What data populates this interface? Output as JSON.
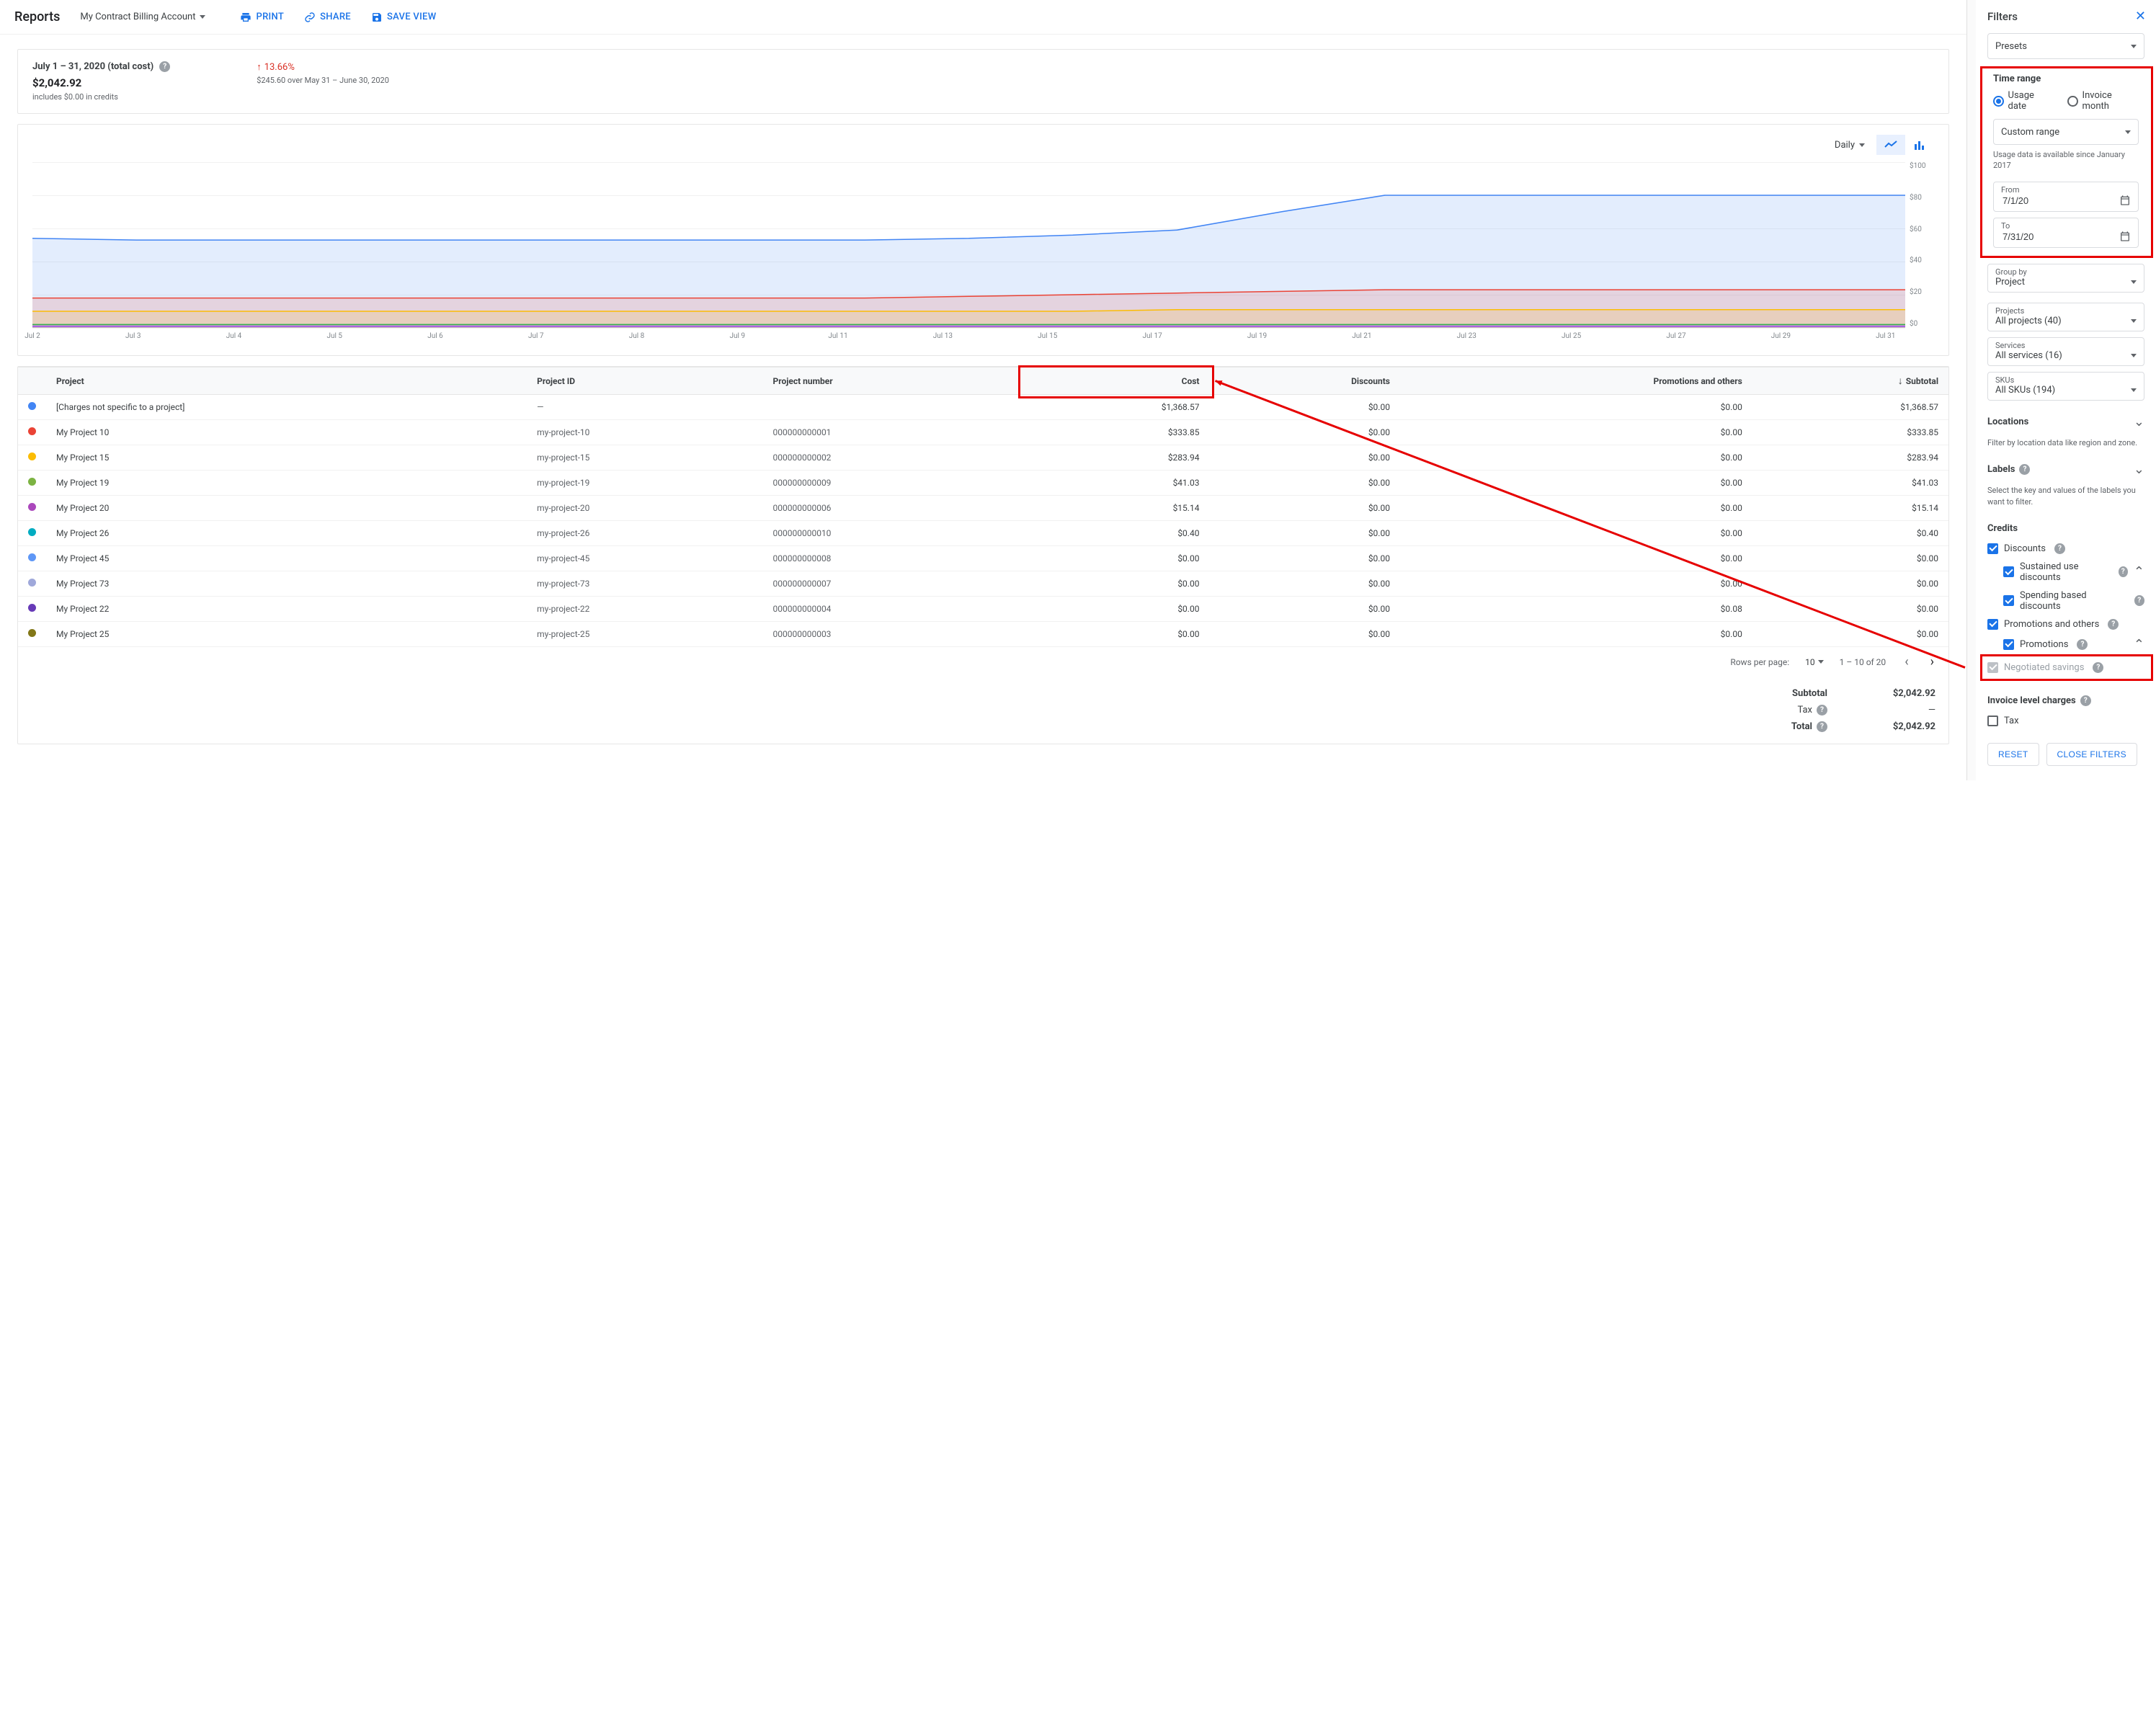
{
  "topbar": {
    "title": "Reports",
    "account": "My Contract Billing Account",
    "print": "PRINT",
    "share": "SHARE",
    "save_view": "SAVE VIEW"
  },
  "summary": {
    "period_label": "July 1 – 31, 2020 (total cost)",
    "amount": "$2,042.92",
    "credits_note": "includes $0.00 in credits",
    "delta_pct": "13.66%",
    "delta_note": "$245.60 over May 31 – June 30, 2020"
  },
  "chart_controls": {
    "granularity": "Daily"
  },
  "chart_data": {
    "type": "area",
    "ylabel": "",
    "ylim": [
      0,
      100
    ],
    "yticks": [
      "$100",
      "$80",
      "$60",
      "$40",
      "$20",
      "$0"
    ],
    "categories": [
      "Jul 2",
      "Jul 3",
      "Jul 4",
      "Jul 5",
      "Jul 6",
      "Jul 7",
      "Jul 8",
      "Jul 9",
      "Jul 11",
      "Jul 13",
      "Jul 15",
      "Jul 17",
      "Jul 19",
      "Jul 21",
      "Jul 23",
      "Jul 25",
      "Jul 27",
      "Jul 29",
      "Jul 31"
    ],
    "series": [
      {
        "name": "[Charges not specific to a project]",
        "color": "#4285f4",
        "values": [
          54,
          53,
          53,
          53,
          53,
          53,
          53,
          53,
          53,
          54,
          56,
          59,
          70,
          80,
          80,
          80,
          80,
          80,
          80
        ]
      },
      {
        "name": "My Project 10",
        "color": "#ea4335",
        "values": [
          18,
          18,
          18,
          18,
          18,
          18,
          18,
          18,
          18,
          19,
          20,
          21,
          22,
          23,
          23,
          23,
          23,
          23,
          23
        ]
      },
      {
        "name": "My Project 15",
        "color": "#fbbc04",
        "values": [
          10,
          10,
          10,
          10,
          10,
          10,
          10,
          10,
          10,
          10,
          10,
          11,
          11,
          11,
          11,
          11,
          11,
          11,
          11
        ]
      },
      {
        "name": "My Project 19",
        "color": "#34a853",
        "values": [
          2,
          2,
          2,
          2,
          2,
          2,
          2,
          2,
          2,
          2,
          2,
          2,
          2,
          2,
          2,
          2,
          2,
          2,
          2
        ]
      },
      {
        "name": "My Project 20",
        "color": "#a142f4",
        "values": [
          1,
          1,
          1,
          1,
          1,
          1,
          1,
          1,
          1,
          1,
          1,
          1,
          1,
          1,
          1,
          1,
          1,
          1,
          1
        ]
      }
    ]
  },
  "table": {
    "headers": {
      "project": "Project",
      "project_id": "Project ID",
      "project_number": "Project number",
      "cost": "Cost",
      "discounts": "Discounts",
      "promotions": "Promotions and others",
      "subtotal": "Subtotal"
    },
    "rows": [
      {
        "dot": "#4285f4",
        "project": "[Charges not specific to a project]",
        "pid": "—",
        "pnum": "",
        "cost": "$1,368.57",
        "disc": "$0.00",
        "promo": "$0.00",
        "sub": "$1,368.57"
      },
      {
        "dot": "#ea4335",
        "project": "My Project 10",
        "pid": "my-project-10",
        "pnum": "000000000001",
        "cost": "$333.85",
        "disc": "$0.00",
        "promo": "$0.00",
        "sub": "$333.85"
      },
      {
        "dot": "#fbbc04",
        "project": "My Project 15",
        "pid": "my-project-15",
        "pnum": "000000000002",
        "cost": "$283.94",
        "disc": "$0.00",
        "promo": "$0.00",
        "sub": "$283.94"
      },
      {
        "dot": "#7cb342",
        "project": "My Project 19",
        "pid": "my-project-19",
        "pnum": "000000000009",
        "cost": "$41.03",
        "disc": "$0.00",
        "promo": "$0.00",
        "sub": "$41.03"
      },
      {
        "dot": "#ab47bc",
        "project": "My Project 20",
        "pid": "my-project-20",
        "pnum": "000000000006",
        "cost": "$15.14",
        "disc": "$0.00",
        "promo": "$0.00",
        "sub": "$15.14"
      },
      {
        "dot": "#00acc1",
        "project": "My Project 26",
        "pid": "my-project-26",
        "pnum": "000000000010",
        "cost": "$0.40",
        "disc": "$0.00",
        "promo": "$0.00",
        "sub": "$0.40"
      },
      {
        "dot": "#5e97f6",
        "project": "My Project 45",
        "pid": "my-project-45",
        "pnum": "000000000008",
        "cost": "$0.00",
        "disc": "$0.00",
        "promo": "$0.00",
        "sub": "$0.00"
      },
      {
        "dot": "#9fa8da",
        "project": "My Project 73",
        "pid": "my-project-73",
        "pnum": "000000000007",
        "cost": "$0.00",
        "disc": "$0.00",
        "promo": "$0.00",
        "sub": "$0.00"
      },
      {
        "dot": "#673ab7",
        "project": "My Project 22",
        "pid": "my-project-22",
        "pnum": "000000000004",
        "cost": "$0.00",
        "disc": "$0.00",
        "promo": "$0.08",
        "sub": "$0.00"
      },
      {
        "dot": "#827717",
        "project": "My Project 25",
        "pid": "my-project-25",
        "pnum": "000000000003",
        "cost": "$0.00",
        "disc": "$0.00",
        "promo": "$0.00",
        "sub": "$0.00"
      }
    ]
  },
  "pager": {
    "rpp_label": "Rows per page:",
    "rpp_value": "10",
    "range": "1 – 10 of 20"
  },
  "totals": {
    "subtotal_label": "Subtotal",
    "subtotal": "$2,042.92",
    "tax_label": "Tax",
    "tax": "—",
    "total_label": "Total",
    "total": "$2,042.92"
  },
  "filters": {
    "title": "Filters",
    "presets": "Presets",
    "time_range_title": "Time range",
    "usage_date": "Usage date",
    "invoice_month": "Invoice month",
    "custom_range": "Custom range",
    "data_note": "Usage data is available since January 2017",
    "from_label": "From",
    "from_value": "7/1/20",
    "to_label": "To",
    "to_value": "7/31/20",
    "group_by_label": "Group by",
    "group_by_value": "Project",
    "projects_label": "Projects",
    "projects_value": "All projects (40)",
    "services_label": "Services",
    "services_value": "All services (16)",
    "skus_label": "SKUs",
    "skus_value": "All SKUs (194)",
    "locations_title": "Locations",
    "locations_hint": "Filter by location data like region and zone.",
    "labels_title": "Labels",
    "labels_hint": "Select the key and values of the labels you want to filter.",
    "credits_title": "Credits",
    "discounts": "Discounts",
    "sustained": "Sustained use discounts",
    "spending": "Spending based discounts",
    "promotions_others": "Promotions and others",
    "promotions": "Promotions",
    "negotiated": "Negotiated savings",
    "invoice_charges": "Invoice level charges",
    "tax_cb": "Tax",
    "reset": "RESET",
    "close": "CLOSE FILTERS"
  }
}
